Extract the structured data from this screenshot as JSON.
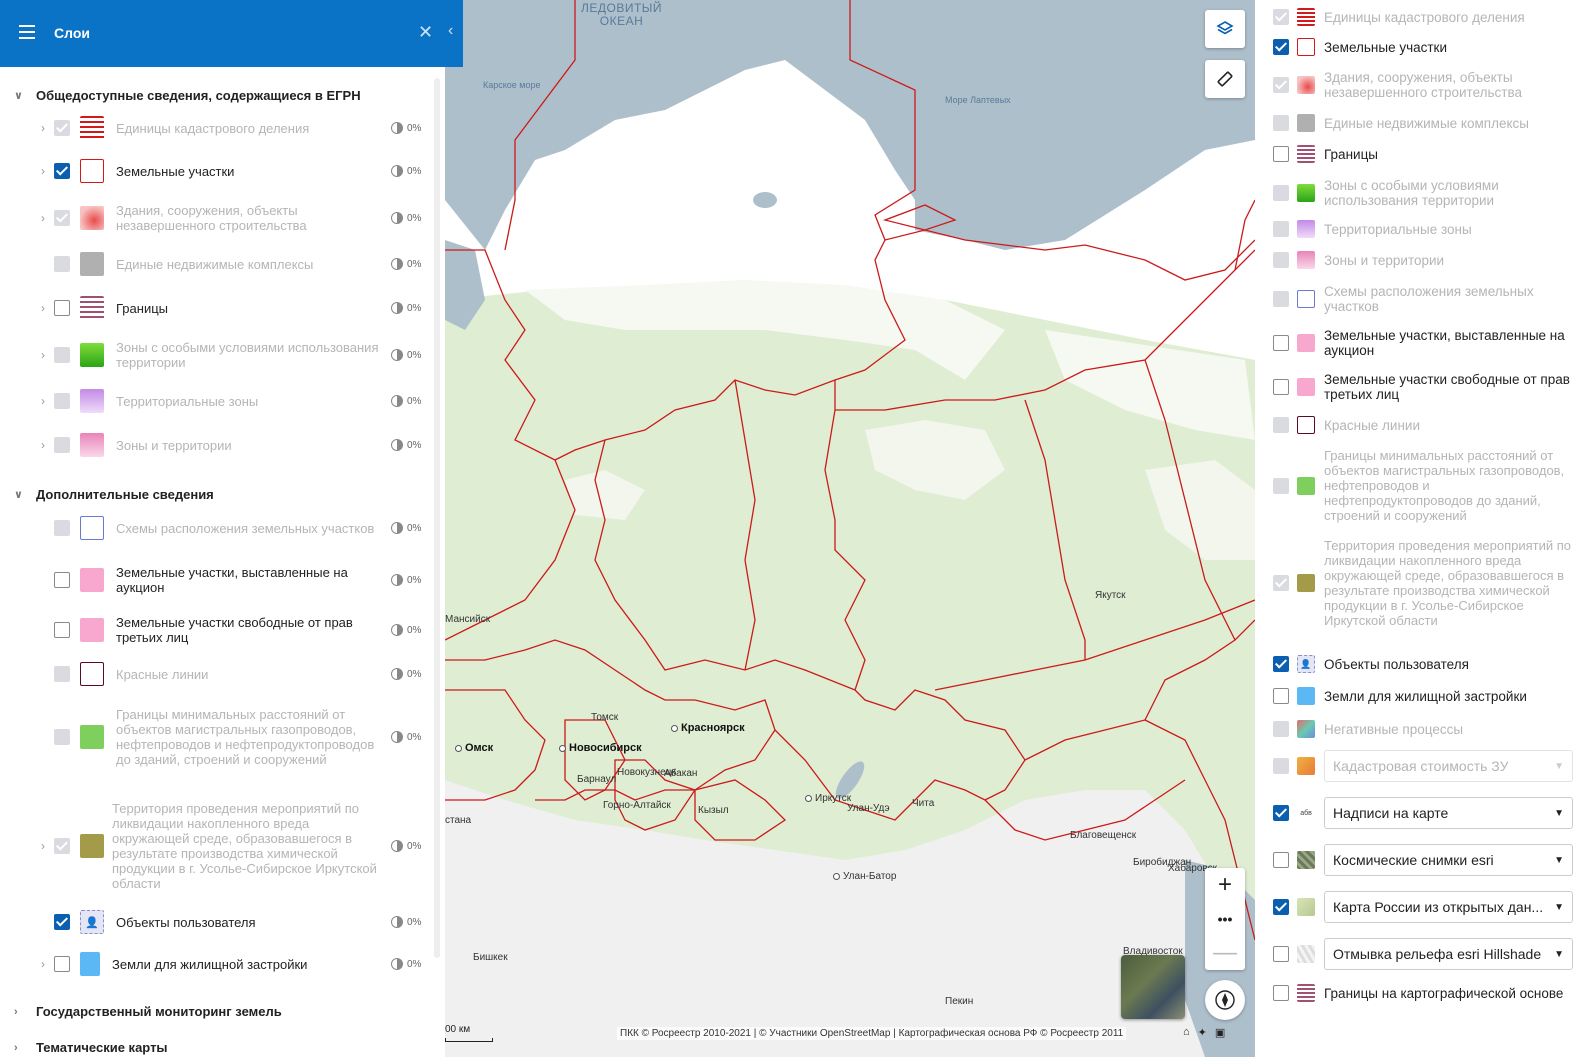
{
  "header": {
    "title": "Слои"
  },
  "left_panel": {
    "sections": [
      {
        "title": "Общедоступные сведения, содержащиеся в ЕГРН"
      },
      {
        "title": "Дополнительные сведения"
      },
      {
        "title": "Государственный мониторинг земель"
      },
      {
        "title": "Тематические карты"
      }
    ],
    "layers": [
      {
        "label": "Единицы кадастрового деления",
        "opacity": "0%"
      },
      {
        "label": "Земельные участки",
        "opacity": "0%"
      },
      {
        "label": "Здания, сооружения, объекты незавершенного строительства",
        "opacity": "0%"
      },
      {
        "label": "Единые недвижимые комплексы",
        "opacity": "0%"
      },
      {
        "label": "Границы",
        "opacity": "0%"
      },
      {
        "label": "Зоны с особыми условиями использования территории",
        "opacity": "0%"
      },
      {
        "label": "Территориальные зоны",
        "opacity": "0%"
      },
      {
        "label": "Зоны и территории",
        "opacity": "0%"
      },
      {
        "label": "Схемы расположения земельных участков",
        "opacity": "0%"
      },
      {
        "label": "Земельные участки, выставленные на аукцион",
        "opacity": "0%"
      },
      {
        "label": "Земельные участки свободные от прав третьих лиц",
        "opacity": "0%"
      },
      {
        "label": "Красные линии",
        "opacity": "0%"
      },
      {
        "label": "Границы минимальных расстояний от объектов магистральных газопроводов, нефтепроводов и нефтепродуктопроводов до зданий, строений и сооружений",
        "opacity": "0%"
      },
      {
        "label": "Территория проведения мероприятий по ликвидации накопленного вреда окружающей среде, образовавшегося в результате производства химической продукции в г. Усолье-Сибирское Иркутской области",
        "opacity": "0%"
      },
      {
        "label": "Объекты пользователя",
        "opacity": "0%"
      },
      {
        "label": "Земли для жилищной застройки",
        "opacity": "0%"
      }
    ]
  },
  "right_panel": {
    "layers": [
      {
        "label": "Единицы кадастрового деления"
      },
      {
        "label": "Земельные участки"
      },
      {
        "label": "Здания, сооружения, объекты незавершенного строительства"
      },
      {
        "label": "Единые недвижимые комплексы"
      },
      {
        "label": "Границы"
      },
      {
        "label": "Зоны с особыми условиями использования территории"
      },
      {
        "label": "Территориальные зоны"
      },
      {
        "label": "Зоны и территории"
      },
      {
        "label": "Схемы расположения земельных участков"
      },
      {
        "label": "Земельные участки, выставленные на аукцион"
      },
      {
        "label": "Земельные участки свободные от прав третьих лиц"
      },
      {
        "label": "Красные линии"
      },
      {
        "label": "Границы минимальных расстояний от объектов магистральных газопроводов, нефтепроводов и нефтепродуктопроводов до зданий, строений и сооружений"
      },
      {
        "label": "Территория проведения мероприятий по ликвидации накопленного вреда окружающей среде, образовавшегося в результате производства химической продукции в г. Усолье-Сибирское Иркутской области"
      },
      {
        "label": "Объекты пользователя"
      },
      {
        "label": "Земли для жилищной застройки"
      },
      {
        "label": "Негативные процессы"
      },
      {
        "label": "Границы на картографической основе"
      }
    ],
    "selects": [
      {
        "value": "Кадастровая стоимость ЗУ"
      },
      {
        "value": "Надписи на карте"
      },
      {
        "value": "Космические снимки esri"
      },
      {
        "value": "Карта России из открытых дан..."
      },
      {
        "value": "Отмывка рельефа esri Hillshade"
      }
    ]
  },
  "map": {
    "ocean_label": "ЛЕДОВИТЫЙ\nОКЕАН",
    "seas": [
      "Карское море",
      "Море Лаптевых"
    ],
    "cities": [
      "Якутск",
      "Мансийск",
      "Томск",
      "Красноярск",
      "Омск",
      "Новосибирск",
      "Барнаул",
      "Новокузнецк",
      "Абакан",
      "Горно-Алтайск",
      "Кызыл",
      "Иркутск",
      "Улан-Удэ",
      "Чита",
      "Благовещенск",
      "Биробиджан",
      "Хабаровск",
      "Улан-Батор",
      "Владивосток",
      "Бишкек",
      "Пекин",
      "стана"
    ],
    "scale": "00 км",
    "attribution": "ПКК © Росреестр 2010-2021 | © Участники OpenStreetMap | Картографическая основа РФ © Росреестр 2011"
  },
  "colors": {
    "header": "#0a73c6",
    "checked": "#0a5fb0",
    "border": "#cc1a1a",
    "land": "#dfedd2",
    "water": "#aebfcc"
  }
}
